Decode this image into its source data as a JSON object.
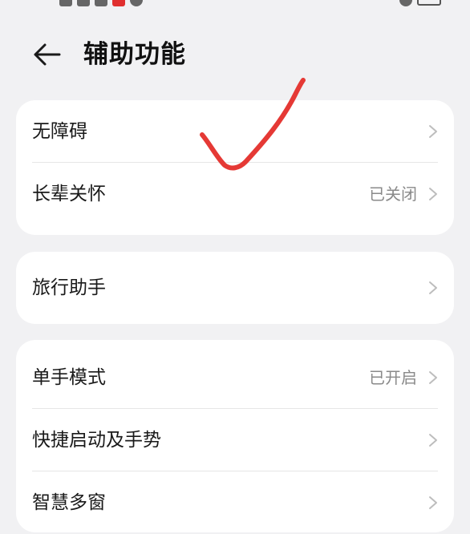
{
  "header": {
    "title": "辅助功能",
    "back_icon": "arrow-left-icon"
  },
  "groups": [
    {
      "items": [
        {
          "label": "无障碍",
          "value": ""
        },
        {
          "label": "长辈关怀",
          "value": "已关闭"
        }
      ]
    },
    {
      "items": [
        {
          "label": "旅行助手",
          "value": ""
        }
      ]
    },
    {
      "items": [
        {
          "label": "单手模式",
          "value": "已开启"
        },
        {
          "label": "快捷启动及手势",
          "value": ""
        },
        {
          "label": "智慧多窗",
          "value": ""
        }
      ]
    }
  ],
  "colors": {
    "background": "#f1f1f3",
    "card": "#ffffff",
    "value_text": "#8a8a8a",
    "checkmark": "#e53935"
  }
}
